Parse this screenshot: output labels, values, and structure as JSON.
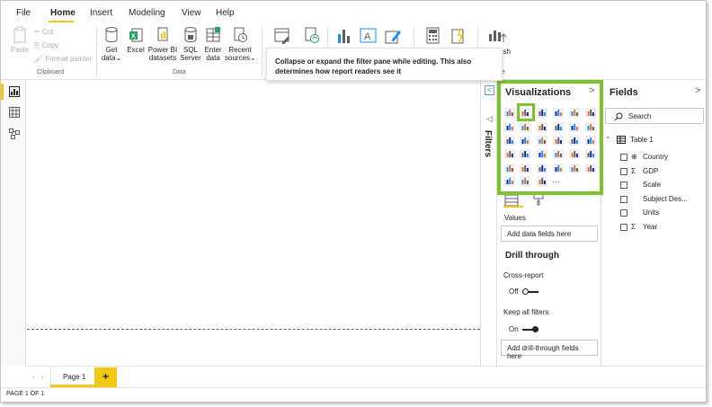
{
  "tabs": [
    "File",
    "Home",
    "Insert",
    "Modeling",
    "View",
    "Help"
  ],
  "active_tab": "Home",
  "clipboard": {
    "paste": "Paste",
    "cut": "Cut",
    "copy": "Copy",
    "format_painter": "Format painter",
    "label": "Clipboard"
  },
  "data_group": {
    "get_data": [
      "Get",
      "data"
    ],
    "excel": "Excel",
    "pbi": [
      "Power BI",
      "datasets"
    ],
    "sql": [
      "SQL",
      "Server"
    ],
    "enter": [
      "Enter",
      "data"
    ],
    "recent": [
      "Recent",
      "sources"
    ],
    "label": "Data"
  },
  "publish_partial": "lish",
  "group_label_partial": "e",
  "tooltip": {
    "line1": "Collapse or expand the filter pane while editing. This also",
    "line2": "determines how report readers see it"
  },
  "filters": {
    "label": "Filters",
    "collapse_glyph": "<"
  },
  "visualizations": {
    "title": "Visualizations",
    "chevron": ">",
    "values_label": "Values",
    "values_placeholder": "Add data fields here",
    "drill_through": "Drill through",
    "cross_report": "Cross-report",
    "cross_report_state": "Off",
    "keep_all_filters": "Keep all filters",
    "keep_all_filters_state": "On",
    "drill_placeholder": "Add drill-through fields here",
    "more": "···",
    "icon_colors": {
      "accent_blue": "#118dff",
      "accent_orange": "#e66c37",
      "accent_teal": "#12239e",
      "highlight_green": "#7cc22a"
    }
  },
  "fields": {
    "title": "Fields",
    "chevron": ">",
    "search_placeholder": "Search",
    "table_name": "Table 1",
    "items": [
      {
        "name": "Country",
        "type": "globe"
      },
      {
        "name": "GDP",
        "type": "sum"
      },
      {
        "name": "Scale",
        "type": ""
      },
      {
        "name": "Subject Des...",
        "type": ""
      },
      {
        "name": "Units",
        "type": ""
      },
      {
        "name": "Year",
        "type": "sum"
      }
    ]
  },
  "pages": {
    "current": "Page 1",
    "add": "+"
  },
  "status": "PAGE 1 OF 1"
}
